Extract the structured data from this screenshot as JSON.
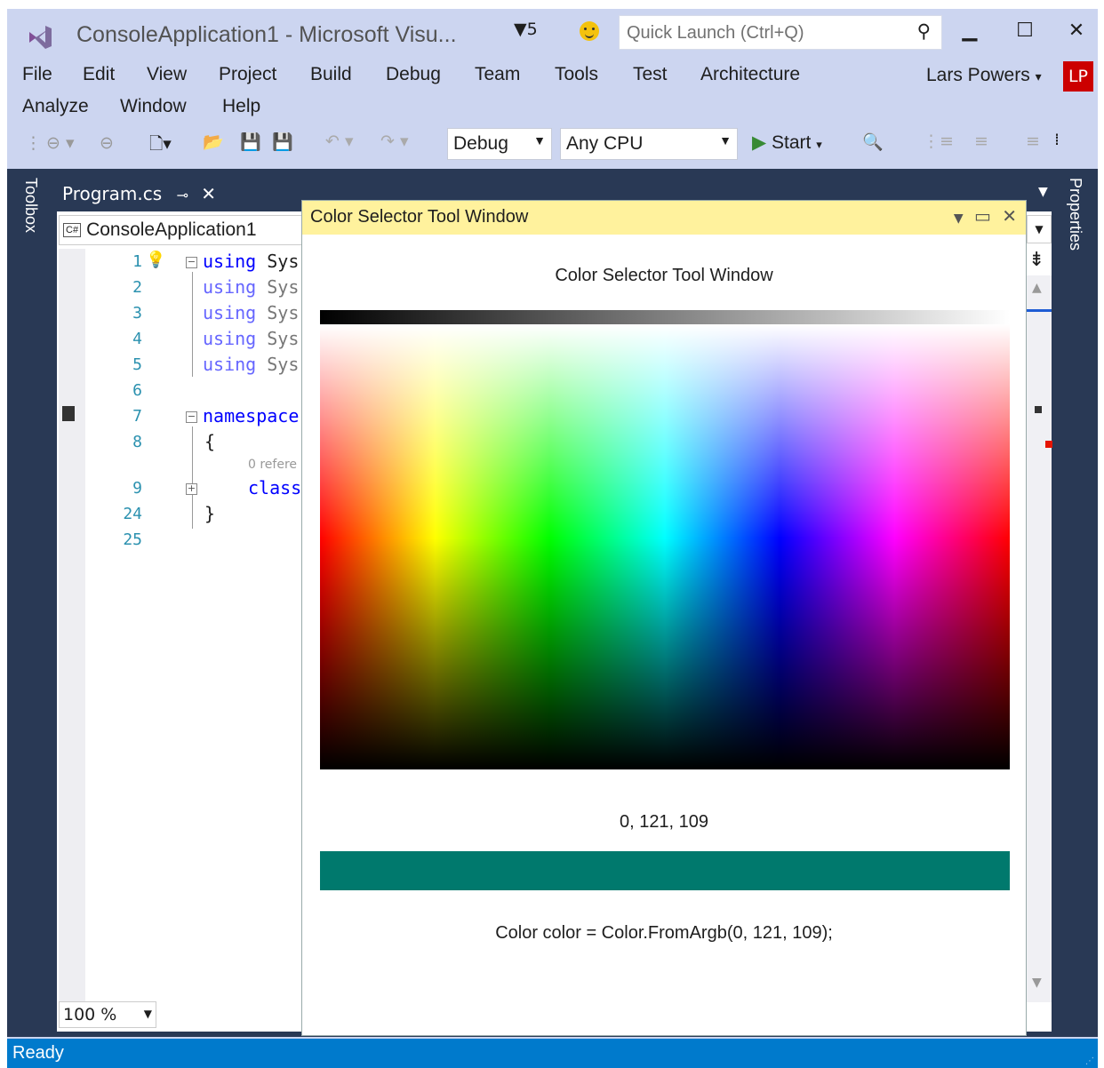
{
  "window": {
    "title": "ConsoleApplication1 - Microsoft Visu...",
    "notification_count": "5",
    "quick_launch_placeholder": "Quick Launch (Ctrl+Q)",
    "user_name": "Lars Powers",
    "user_initials": "LP"
  },
  "menu": {
    "row1": [
      "File",
      "Edit",
      "View",
      "Project",
      "Build",
      "Debug",
      "Team",
      "Tools",
      "Test",
      "Architecture"
    ],
    "row2": [
      "Analyze",
      "Window",
      "Help"
    ]
  },
  "toolbar": {
    "config": "Debug",
    "platform": "Any CPU",
    "start_label": "Start"
  },
  "side_panels": {
    "left": "Toolbox",
    "right": "Properties"
  },
  "editor": {
    "tab_name": "Program.cs",
    "project_name": "ConsoleApplication1",
    "lines": [
      {
        "num": "1",
        "kw": "using",
        "rest": " Sys"
      },
      {
        "num": "2",
        "kw": "using",
        "rest": " Sys"
      },
      {
        "num": "3",
        "kw": "using",
        "rest": " Sys"
      },
      {
        "num": "4",
        "kw": "using",
        "rest": " Sys"
      },
      {
        "num": "5",
        "kw": "using",
        "rest": " Sys"
      },
      {
        "num": "6",
        "kw": "",
        "rest": ""
      },
      {
        "num": "7",
        "kw": "namespace",
        "rest": ""
      },
      {
        "num": "8",
        "kw": "",
        "rest": "{"
      },
      {
        "num": "9",
        "kw": "class",
        "rest": ""
      },
      {
        "num": "24",
        "kw": "",
        "rest": "}"
      },
      {
        "num": "25",
        "kw": "",
        "rest": ""
      }
    ],
    "codelens": "0 refere",
    "zoom": "100 %"
  },
  "tool_window": {
    "title": "Color Selector Tool Window",
    "heading": "Color Selector Tool Window",
    "rgb_text": "0, 121, 109",
    "selected_color": "#00796D",
    "code_text": "Color color = Color.FromArgb(0, 121, 109);"
  },
  "status_bar": {
    "text": "Ready"
  },
  "colors": {
    "chrome": "#CCD5F0",
    "dark_panel": "#293955",
    "tool_window_header": "#FFF29D",
    "status_bar": "#007ACC"
  }
}
